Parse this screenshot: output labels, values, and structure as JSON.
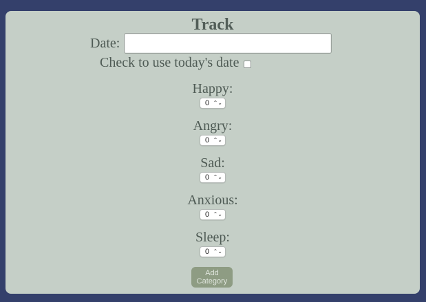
{
  "form": {
    "title": "Track",
    "date_label": "Date:",
    "date_value": "",
    "today_label": "Check to use today's date",
    "today_checked": false,
    "categories": [
      {
        "label": "Happy:",
        "value": "0"
      },
      {
        "label": "Angry:",
        "value": "0"
      },
      {
        "label": "Sad:",
        "value": "0"
      },
      {
        "label": "Anxious:",
        "value": "0"
      },
      {
        "label": "Sleep:",
        "value": "0"
      }
    ],
    "add_button_label": "Add Category"
  },
  "colors": {
    "page_background": "#34406b",
    "panel_background": "#c5cfc7",
    "text": "#4f5b55",
    "button_background": "#8e9c83",
    "button_text": "#dfe5dc"
  },
  "icons": {
    "select_indicator": "chevron-up-down-icon"
  }
}
